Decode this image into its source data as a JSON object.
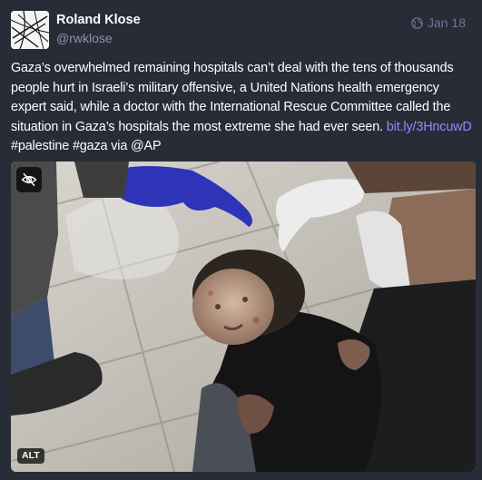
{
  "author": {
    "display_name": "Roland Klose",
    "handle": "@rwklose"
  },
  "meta": {
    "visibility_icon": "globe-icon",
    "date": "Jan 18"
  },
  "post": {
    "text_before_link": "Gaza’s overwhelmed remaining hospitals can’t deal with the tens of thousands people hurt in Israeli’s military offensive, a United Nations health emergency expert said, while a doctor with the International Rescue Committee called the situation in Gaza’s hospitals the most extreme she had ever seen. ",
    "link_text": "bit.ly/3HncuwD",
    "text_after_link": " #palestine #gaza via @AP"
  },
  "media": {
    "hide_icon": "eye-slash-icon",
    "alt_badge": "ALT"
  },
  "colors": {
    "background": "#282c37",
    "link": "#8c8dff",
    "muted": "#8d93ab"
  }
}
